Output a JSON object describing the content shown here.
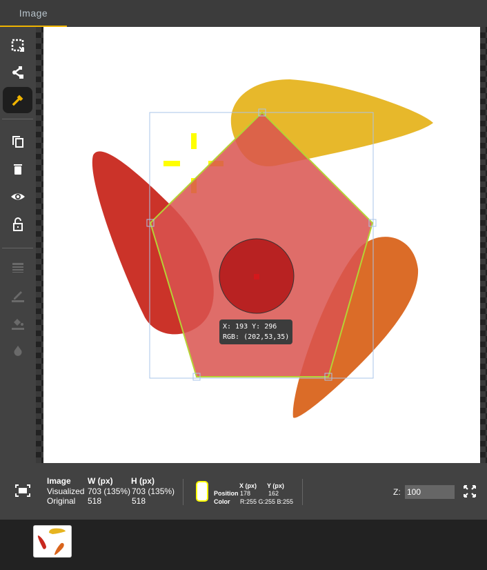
{
  "tabs": [
    {
      "label": "Image",
      "active": true
    }
  ],
  "toolbar": {
    "tools": [
      {
        "name": "select-region",
        "icon": "select-icon"
      },
      {
        "name": "polygon",
        "icon": "share-nodes-icon"
      },
      {
        "name": "color-picker",
        "icon": "eyedropper-icon",
        "active": true
      },
      {
        "name": "duplicate",
        "icon": "copy-icon"
      },
      {
        "name": "delete",
        "icon": "trash-icon"
      },
      {
        "name": "visibility",
        "icon": "eye-icon"
      },
      {
        "name": "lock",
        "icon": "lock-open-icon"
      },
      {
        "name": "line-weight",
        "icon": "lines-icon",
        "disabled": true
      },
      {
        "name": "stroke-color",
        "icon": "pencil-icon",
        "disabled": true
      },
      {
        "name": "fill-color",
        "icon": "paint-bucket-icon",
        "disabled": true
      },
      {
        "name": "opacity",
        "icon": "droplet-icon",
        "disabled": true
      }
    ],
    "accent": "#f0b400"
  },
  "tooltip": {
    "line1": "X: 193 Y: 296",
    "line2": "RGB: (202,53,35)"
  },
  "info": {
    "image_label": "Image",
    "w_label": "W (px)",
    "h_label": "H (px)",
    "visualized_label": "Visualized",
    "visualized_w": "703 (135%)",
    "visualized_h": "703 (135%)",
    "original_label": "Original",
    "original_w": "518",
    "original_h": "518",
    "x_label": "X (px)",
    "y_label": "Y (px)",
    "position_label": "Position",
    "position_x": "178",
    "position_y": "162",
    "color_label": "Color",
    "color_value": "R:255 G:255 B:255",
    "swatch_color": "#ffffff",
    "z_label": "Z:",
    "z_value": "100"
  },
  "colors": {
    "polygon_fill": "#d9534f",
    "polygon_stroke": "#b5d335",
    "yellow": "#e6b420",
    "red": "#c8281e",
    "orange": "#d9641c"
  }
}
